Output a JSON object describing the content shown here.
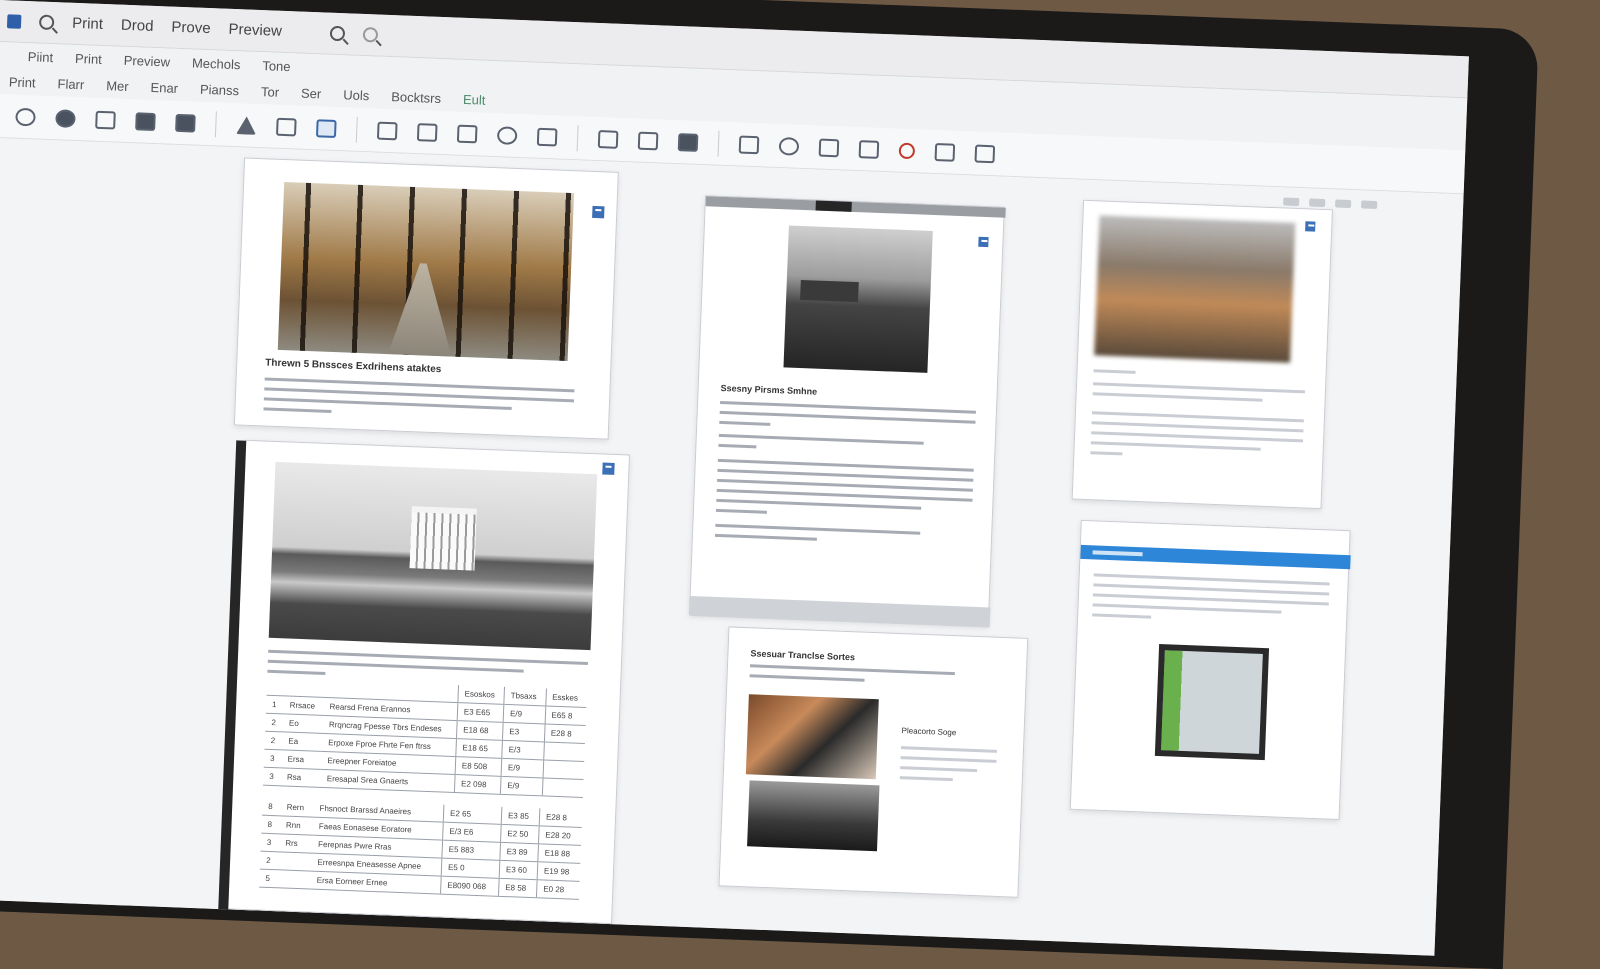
{
  "titlebar": {
    "items": [
      "Print",
      "Drod",
      "Prove",
      "Preview"
    ]
  },
  "menu_row_1": {
    "items": [
      "Piint",
      "Print",
      "Preview",
      "Mechols",
      "Tone"
    ]
  },
  "menu_row_2": {
    "items": [
      "Print",
      "Flarr",
      "Mer",
      "Enar",
      "Pianss",
      "Tor",
      "Ser",
      "Uols",
      "Bocktsrs",
      "Eult"
    ]
  },
  "pages": {
    "page1": {
      "title": "Threwn 5 Bnssces Exdrihens ataktes"
    },
    "page3": {
      "title": "Ssesny Pirsms Smhne"
    },
    "page4": {
      "title": "Ssesuar Tranclse Sortes",
      "side_caption": "Pleacorto Soge"
    },
    "page2": {
      "table_1": [
        [
          "1",
          "Rrsace",
          "Rearsd Frena Erannos",
          "E3 E65",
          "E/9",
          "E65 8"
        ],
        [
          "2",
          "Eo",
          "Rrqncrag Fpesse Tbrs Endeses",
          "E18 68",
          "E3",
          "E28 8"
        ],
        [
          "2",
          "Ea",
          "Erpoxe Fproe Fhrte Fen ftrss",
          "E18 65",
          "E/3",
          ""
        ],
        [
          "3",
          "Ersa",
          "Ereepner Foreiatoe",
          "E8 508",
          "E/9",
          ""
        ],
        [
          "3",
          "Rsa",
          "Eresapal Srea Gnaerts",
          "E2 098",
          "E/9",
          ""
        ]
      ],
      "table_1_header": [
        "",
        "",
        "",
        "Esoskos",
        "Tbsaxs",
        "Esskes"
      ],
      "table_2": [
        [
          "8",
          "Rern",
          "Fhsnoct Brarssd Anaeires",
          "E2 65",
          "E3 85",
          "E28 8"
        ],
        [
          "8",
          "Rnn",
          "Faeas Eonasese Eoratore",
          "E/3 E6",
          "E2 50",
          "E28 20"
        ],
        [
          "3",
          "Rrs",
          "Ferepnas Pwre Rras",
          "E5 883",
          "E3 89",
          "E18 88"
        ],
        [
          "2",
          "",
          "Erreesnpa Eneasesse Apnee",
          "E5 0",
          "E3 60",
          "E19 98"
        ],
        [
          "5",
          "",
          "Ersa Eorneer Ernee",
          "E8090 068",
          "E8 58",
          "E0 28"
        ]
      ]
    }
  },
  "colors": {
    "accent": "#3b6fb6",
    "highlight_strip": "#2d86d8"
  }
}
